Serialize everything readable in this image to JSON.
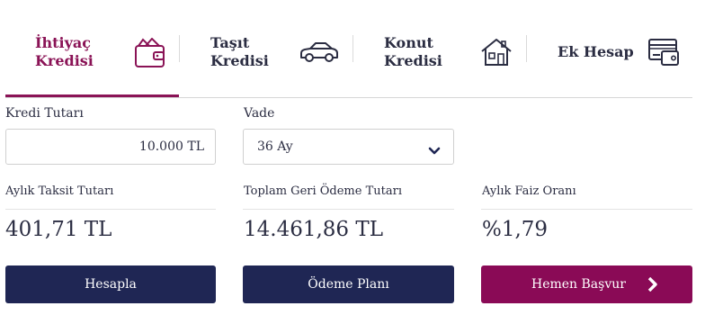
{
  "tabs": [
    {
      "label": "İhtiyaç\nKredisi",
      "icon": "wallet-icon",
      "active": true
    },
    {
      "label": "Taşıt\nKredisi",
      "icon": "car-icon",
      "active": false
    },
    {
      "label": "Konut\nKredisi",
      "icon": "house-icon",
      "active": false
    },
    {
      "label": "Ek Hesap",
      "icon": "card-icon",
      "active": false
    }
  ],
  "form": {
    "amount_label": "Kredi Tutarı",
    "amount_value": "10.000 TL",
    "term_label": "Vade",
    "term_value": "36 Ay"
  },
  "results": {
    "installment_label": "Aylık Taksit Tutarı",
    "installment_value": "401,71 TL",
    "total_label": "Toplam Geri Ödeme Tutarı",
    "total_value": "14.461,86 TL",
    "rate_label": "Aylık Faiz Oranı",
    "rate_value": "%1,79"
  },
  "buttons": {
    "calculate": "Hesapla",
    "payment_plan": "Ödeme Planı",
    "apply_now": "Hemen Başvur"
  },
  "colors": {
    "accent": "#8a0a56",
    "navy": "#1f2654",
    "text": "#2b2d42"
  }
}
